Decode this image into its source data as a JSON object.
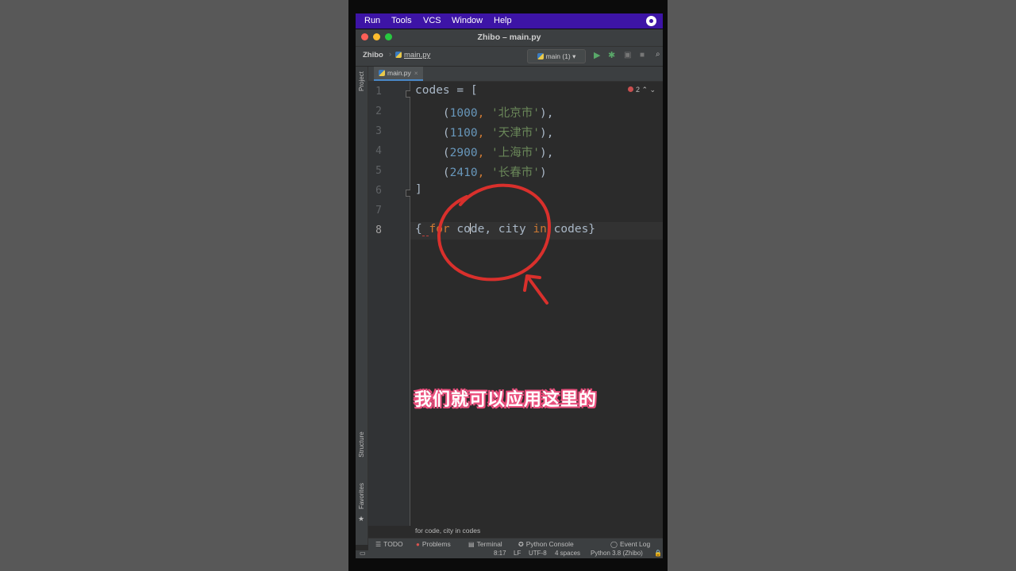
{
  "menubar": {
    "items": [
      "Run",
      "Tools",
      "VCS",
      "Window",
      "Help"
    ]
  },
  "window": {
    "title": "Zhibo – main.py"
  },
  "navbar": {
    "project": "Zhibo",
    "file": "main.py",
    "branch": "main (1)"
  },
  "side_tabs": {
    "project": "Project",
    "structure": "Structure",
    "favorites": "Favorites"
  },
  "editor": {
    "tab": "main.py",
    "problems": "2",
    "line_numbers": [
      "1",
      "2",
      "3",
      "4",
      "5",
      "6",
      "7",
      "8"
    ],
    "current_line": "8",
    "lines": {
      "l1": "codes = [",
      "l2": {
        "open": "    (",
        "num": "1000",
        "sep": ", ",
        "str": "'北京市'",
        "close": "),"
      },
      "l3": {
        "open": "    (",
        "num": "1100",
        "sep": ", ",
        "str": "'天津市'",
        "close": "),"
      },
      "l4": {
        "open": "    (",
        "num": "2900",
        "sep": ", ",
        "str": "'上海市'",
        "close": "),"
      },
      "l5": {
        "open": "    (",
        "num": "2410",
        "sep": ", ",
        "str": "'长春市'",
        "close": ")"
      },
      "l6": "]",
      "l8": {
        "brace_open": "{",
        "space": " ",
        "kw_for": "for",
        "code_a": " co",
        "code_b": "de, city ",
        "kw_in": "in",
        "rest": " codes}"
      }
    }
  },
  "hint": "for code, city in codes",
  "toolwindows": {
    "todo": "TODO",
    "problems": "Problems",
    "terminal": "Terminal",
    "python_console": "Python Console",
    "event_log": "Event Log"
  },
  "statusbar": {
    "position": "8:17",
    "line_sep": "LF",
    "encoding": "UTF-8",
    "indent": "4 spaces",
    "interpreter": "Python 3.8 (Zhibo)"
  },
  "subtitle": "我们就可以应用这里的",
  "colors": {
    "menubar_bg": "#3d14a6",
    "annotation_red": "#d9302c",
    "keyword": "#cc7832",
    "number": "#6897bb",
    "string": "#6a8759"
  }
}
